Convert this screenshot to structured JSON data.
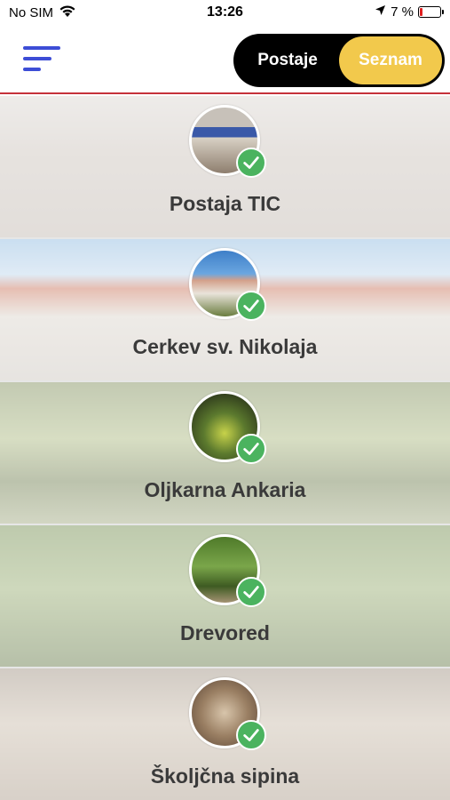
{
  "status_bar": {
    "carrier": "No SIM",
    "time": "13:26",
    "battery_percent": "7 %",
    "battery_color": "#e02020"
  },
  "header": {
    "menu_icon": "hamburger-menu-icon",
    "toggle": {
      "left_label": "Postaje",
      "right_label": "Seznam",
      "active": "Seznam",
      "active_color": "#f2c94c"
    },
    "accent_color": "#3d4dd6",
    "divider_color": "#c5323a"
  },
  "stations": [
    {
      "name": "Postaja TIC",
      "completed": true
    },
    {
      "name": "Cerkev sv. Nikolaja",
      "completed": true
    },
    {
      "name": "Oljkarna Ankaria",
      "completed": true
    },
    {
      "name": "Drevored",
      "completed": true
    },
    {
      "name": "Školjčna sipina",
      "completed": true
    }
  ],
  "check_color": "#4bb35f"
}
